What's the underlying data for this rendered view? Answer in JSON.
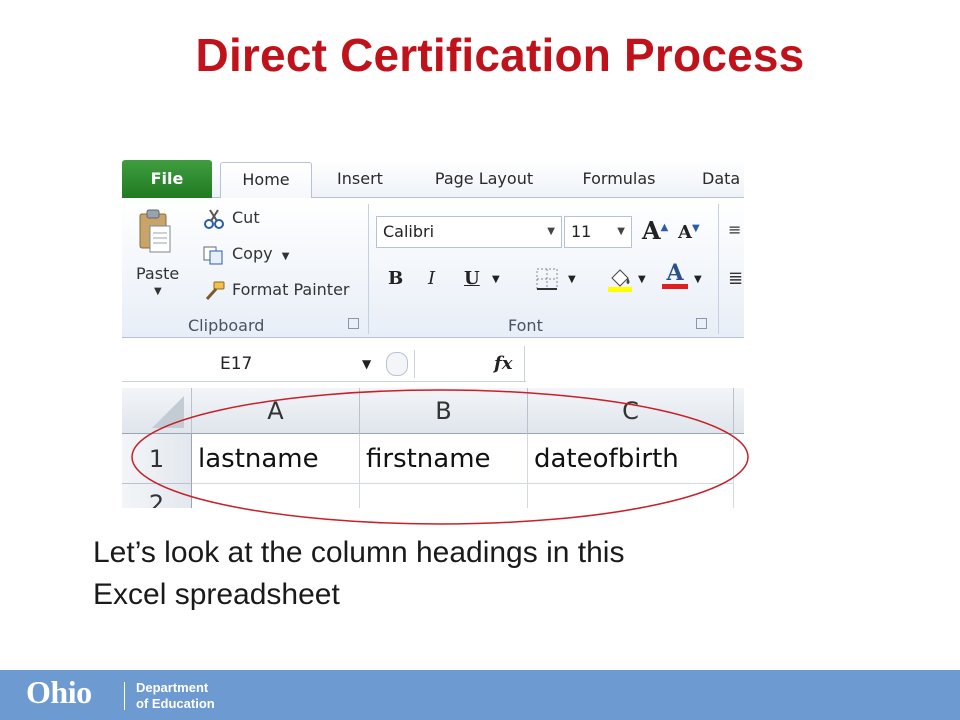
{
  "slide": {
    "title": "Direct Certification Process",
    "caption_line1": "Let’s look at the column headings in this",
    "caption_line2": "Excel spreadsheet"
  },
  "excel": {
    "tabs": [
      "File",
      "Home",
      "Insert",
      "Page Layout",
      "Formulas",
      "Data"
    ],
    "clipboard": {
      "paste_label": "Paste",
      "cut_label": "Cut",
      "copy_label": "Copy",
      "format_painter_label": "Format Painter",
      "group_label": "Clipboard"
    },
    "font": {
      "font_name": "Calibri",
      "font_size": "11",
      "bold_label": "B",
      "italic_label": "I",
      "underline_label": "U",
      "grow_label": "A",
      "shrink_label": "A",
      "font_color_label": "A",
      "group_label": "Font"
    },
    "name_box": "E17",
    "fx_label": "fx",
    "columns": [
      "A",
      "B",
      "C"
    ],
    "rows": [
      {
        "number": "1",
        "cells": [
          "lastname",
          "firstname",
          "dateofbirth"
        ]
      },
      {
        "number": "2",
        "cells": [
          "",
          "",
          ""
        ]
      }
    ],
    "colors": {
      "file_tab": "#217a21",
      "highlight_oval": "#c8202a",
      "fill_highlight": "#ffff00",
      "font_color": "#e02020"
    }
  },
  "footer": {
    "logo_text": "Ohio",
    "department_line1": "Department",
    "department_line2": "of Education",
    "background": "#6d9ad1"
  }
}
